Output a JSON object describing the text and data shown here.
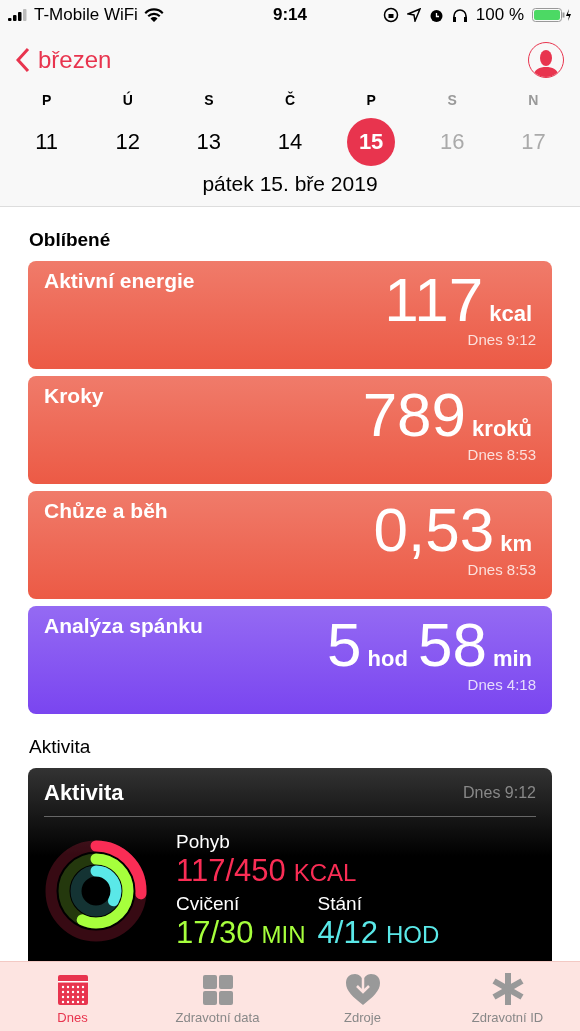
{
  "status_bar": {
    "carrier": "T-Mobile WiFi",
    "time": "9:14",
    "battery": "100 %"
  },
  "nav": {
    "back": "březen"
  },
  "week": [
    {
      "letter": "P",
      "day": "11",
      "selected": false,
      "dimmed": false
    },
    {
      "letter": "Ú",
      "day": "12",
      "selected": false,
      "dimmed": false
    },
    {
      "letter": "S",
      "day": "13",
      "selected": false,
      "dimmed": false
    },
    {
      "letter": "Č",
      "day": "14",
      "selected": false,
      "dimmed": false
    },
    {
      "letter": "P",
      "day": "15",
      "selected": true,
      "dimmed": false
    },
    {
      "letter": "S",
      "day": "16",
      "selected": false,
      "dimmed": true
    },
    {
      "letter": "N",
      "day": "17",
      "selected": false,
      "dimmed": true
    }
  ],
  "date_title": "pátek 15. bře 2019",
  "favorites": {
    "title": "Oblíbené",
    "cards": [
      {
        "title": "Aktivní energie",
        "color": "#ec5a45",
        "parts": [
          {
            "number": "117",
            "unit": "kcal"
          }
        ],
        "time": "Dnes 9:12"
      },
      {
        "title": "Kroky",
        "color": "#ec5a45",
        "parts": [
          {
            "number": "789",
            "unit": "kroků"
          }
        ],
        "time": "Dnes 8:53"
      },
      {
        "title": "Chůze a běh",
        "color": "#ec5a45",
        "parts": [
          {
            "number": "0,53",
            "unit": "km"
          }
        ],
        "time": "Dnes 8:53"
      },
      {
        "title": "Analýza spánku",
        "color": "#7a45f0",
        "parts": [
          {
            "number": "5",
            "unit": "hod"
          },
          {
            "number": "58",
            "unit": "min"
          }
        ],
        "time": "Dnes 4:18"
      }
    ]
  },
  "activity": {
    "section_title": "Aktivita",
    "card_title": "Aktivita",
    "time": "Dnes 9:12",
    "rings": [
      {
        "label": "Pohyb",
        "value": "117/450",
        "unit": "KCAL",
        "color": "#fa2d55"
      },
      {
        "label": "Cvičení",
        "value": "17/30",
        "unit": "MIN",
        "color": "#a6ff3c"
      },
      {
        "label": "Stání",
        "value": "4/12",
        "unit": "HOD",
        "color": "#5ae8e8"
      }
    ]
  },
  "tabs": [
    {
      "label": "Dnes",
      "selected": true
    },
    {
      "label": "Zdravotní data",
      "selected": false
    },
    {
      "label": "Zdroje",
      "selected": false
    },
    {
      "label": "Zdravotní ID",
      "selected": false
    }
  ]
}
